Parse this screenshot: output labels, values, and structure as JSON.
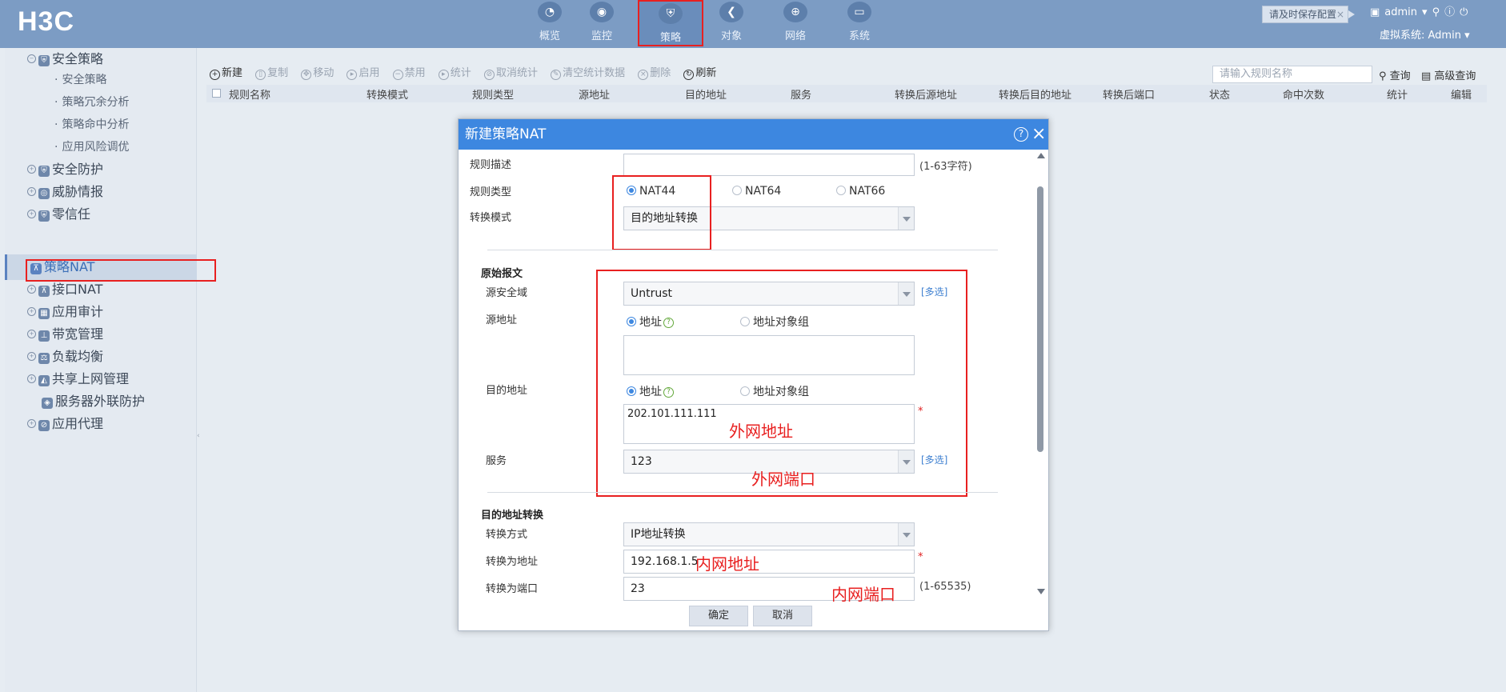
{
  "header": {
    "logo": "H3C",
    "nav": [
      {
        "label": "概览",
        "icon": "gauge-icon",
        "glyph": "◔"
      },
      {
        "label": "监控",
        "icon": "camera-icon",
        "glyph": "◉"
      },
      {
        "label": "策略",
        "icon": "shield-icon",
        "glyph": "⛨"
      },
      {
        "label": "对象",
        "icon": "share-icon",
        "glyph": "❮"
      },
      {
        "label": "网络",
        "icon": "globe-icon",
        "glyph": "⊕"
      },
      {
        "label": "系统",
        "icon": "monitor-icon",
        "glyph": "▭"
      }
    ],
    "active_nav": "策略",
    "save_config": "请及时保存配置",
    "user": "admin",
    "vsys": "虚拟系统: Admin"
  },
  "sidebar": {
    "groups": [
      {
        "label": "安全策略",
        "icon": "shield-icon",
        "glyph": "⛨"
      },
      {
        "label": "安全防护",
        "icon": "shield-icon",
        "glyph": "⛨"
      },
      {
        "label": "威胁情报",
        "icon": "eye-icon",
        "glyph": "◎"
      },
      {
        "label": "零信任",
        "icon": "shield-icon",
        "glyph": "⛨"
      },
      {
        "label": "策略NAT",
        "icon": "network-icon",
        "glyph": "⊼"
      },
      {
        "label": "接口NAT",
        "icon": "network-icon",
        "glyph": "⊼"
      },
      {
        "label": "应用审计",
        "icon": "grid-icon",
        "glyph": "▦"
      },
      {
        "label": "带宽管理",
        "icon": "tree-icon",
        "glyph": "⊥"
      },
      {
        "label": "负载均衡",
        "icon": "balance-icon",
        "glyph": "⚖"
      },
      {
        "label": "共享上网管理",
        "icon": "people-icon",
        "glyph": "◭"
      },
      {
        "label": "服务器外联防护",
        "icon": "server-icon",
        "glyph": "◈"
      },
      {
        "label": "应用代理",
        "icon": "compass-icon",
        "glyph": "⊘"
      }
    ],
    "sub_items": [
      "安全策略",
      "策略冗余分析",
      "策略命中分析",
      "应用风险调优"
    ],
    "active": "策略NAT"
  },
  "toolbar": {
    "buttons": [
      {
        "label": "新建",
        "icon": "plus-icon",
        "glyph": "+"
      },
      {
        "label": "复制",
        "icon": "copy-icon",
        "glyph": "▯"
      },
      {
        "label": "移动",
        "icon": "move-icon",
        "glyph": "✥"
      },
      {
        "label": "启用",
        "icon": "play-icon",
        "glyph": "▸"
      },
      {
        "label": "禁用",
        "icon": "minus-icon",
        "glyph": "−"
      },
      {
        "label": "统计",
        "icon": "play-icon",
        "glyph": "▸"
      },
      {
        "label": "取消统计",
        "icon": "ban-icon",
        "glyph": "⊘"
      },
      {
        "label": "清空统计数据",
        "icon": "broom-icon",
        "glyph": "✎"
      },
      {
        "label": "删除",
        "icon": "close-icon",
        "glyph": "×"
      },
      {
        "label": "刷新",
        "icon": "refresh-icon",
        "glyph": "↻"
      }
    ],
    "search_placeholder": "请输入规则名称",
    "query_label": "查询",
    "advanced_label": "高级查询"
  },
  "table": {
    "columns": [
      "规则名称",
      "转换模式",
      "规则类型",
      "源地址",
      "目的地址",
      "服务",
      "转换后源地址",
      "转换后目的地址",
      "转换后端口",
      "状态",
      "命中次数",
      "统计",
      "编辑"
    ]
  },
  "dialog": {
    "title": "新建策略NAT",
    "rule_desc_label": "规则描述",
    "rule_desc_value": "",
    "rule_desc_hint": "(1-63字符)",
    "rule_type_label": "规则类型",
    "rule_types": [
      "NAT44",
      "NAT64",
      "NAT66"
    ],
    "rule_type_selected": "NAT44",
    "mode_label": "转换模式",
    "mode_value": "目的地址转换",
    "original_section": "原始报文",
    "src_zone_label": "源安全域",
    "src_zone_value": "Untrust",
    "multi_select": "[多选]",
    "src_addr_label": "源地址",
    "addr_option": "地址",
    "addr_group_option": "地址对象组",
    "src_addr_value": "",
    "dst_addr_label": "目的地址",
    "dst_addr_value": "202.101.111.111",
    "service_label": "服务",
    "service_value": "123",
    "dst_nat_section": "目的地址转换",
    "method_label": "转换方式",
    "method_value": "IP地址转换",
    "to_addr_label": "转换为地址",
    "to_addr_value": "192.168.1.5",
    "to_port_label": "转换为端口",
    "to_port_value": "23",
    "port_hint": "(1-65535)",
    "required_mark": "*",
    "ok_label": "确定",
    "cancel_label": "取消"
  },
  "annotations": {
    "external_address": "外网地址",
    "external_port": "外网端口",
    "internal_address": "内网地址",
    "internal_port": "内网端口"
  },
  "colors": {
    "header_bg": "#7c9cc4",
    "dialog_title_bg": "#3d87e0",
    "annotation_red": "#e82020"
  }
}
